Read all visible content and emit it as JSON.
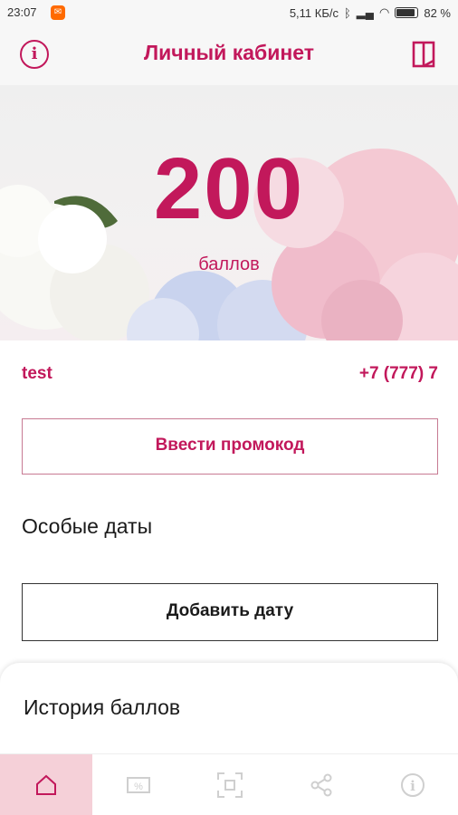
{
  "status_bar": {
    "time": "23:07",
    "network_speed": "5,11 КБ/с",
    "battery": "82 %"
  },
  "header": {
    "title": "Личный кабинет"
  },
  "points": {
    "value": "200",
    "label": "баллов"
  },
  "user": {
    "name": "test",
    "phone": "+7 (777) 7"
  },
  "buttons": {
    "promo": "Ввести промокод",
    "add_date": "Добавить дату"
  },
  "sections": {
    "special_dates": "Особые даты",
    "points_history": "История баллов"
  },
  "bottom_nav": {
    "items": [
      "home-icon",
      "discount-icon",
      "scan-icon",
      "share-icon",
      "info-icon"
    ],
    "active_index": 0
  },
  "colors": {
    "accent": "#c2185b",
    "nav_active_bg": "#f5d0d8"
  }
}
